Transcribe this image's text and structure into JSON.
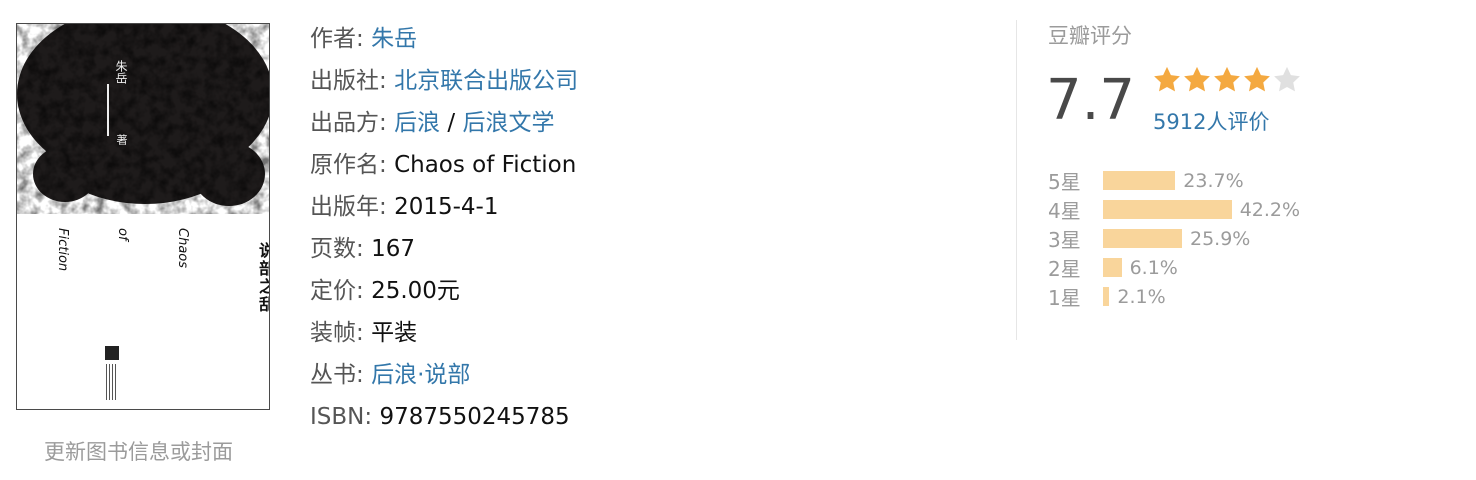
{
  "cover": {
    "title": "说部之乱",
    "english_title_1": "Chaos",
    "english_title_2": "of",
    "english_title_3": "Fiction",
    "author": "朱岳",
    "author_mark": "著"
  },
  "update_link": "更新图书信息或封面",
  "info": {
    "author_label": "作者:",
    "author": "朱岳",
    "publisher_label": "出版社:",
    "publisher": "北京联合出版公司",
    "producer_label": "出品方:",
    "producer_1": "后浪",
    "producer_sep": "/",
    "producer_2": "后浪文学",
    "original_title_label": "原作名:",
    "original_title": "Chaos of Fiction",
    "pub_year_label": "出版年:",
    "pub_year": "2015-4-1",
    "pages_label": "页数:",
    "pages": "167",
    "price_label": "定价:",
    "price": "25.00元",
    "binding_label": "装帧:",
    "binding": "平装",
    "series_label": "丛书:",
    "series": "后浪·说部",
    "isbn_label": "ISBN:",
    "isbn": "9787550245785"
  },
  "rating": {
    "title": "豆瓣评分",
    "score": "7.7",
    "stars_filled": 4,
    "stars_total": 5,
    "count_text": "5912人评价",
    "star_color": "#f4a940",
    "star_empty_color": "#e0e0e0",
    "bar_color": "#f9d59b",
    "link_color": "#3377aa",
    "distribution": [
      {
        "label": "5星",
        "percent": 23.7,
        "text": "23.7%"
      },
      {
        "label": "4星",
        "percent": 42.2,
        "text": "42.2%"
      },
      {
        "label": "3星",
        "percent": 25.9,
        "text": "25.9%"
      },
      {
        "label": "2星",
        "percent": 6.1,
        "text": "6.1%"
      },
      {
        "label": "1星",
        "percent": 2.1,
        "text": "2.1%"
      }
    ]
  }
}
